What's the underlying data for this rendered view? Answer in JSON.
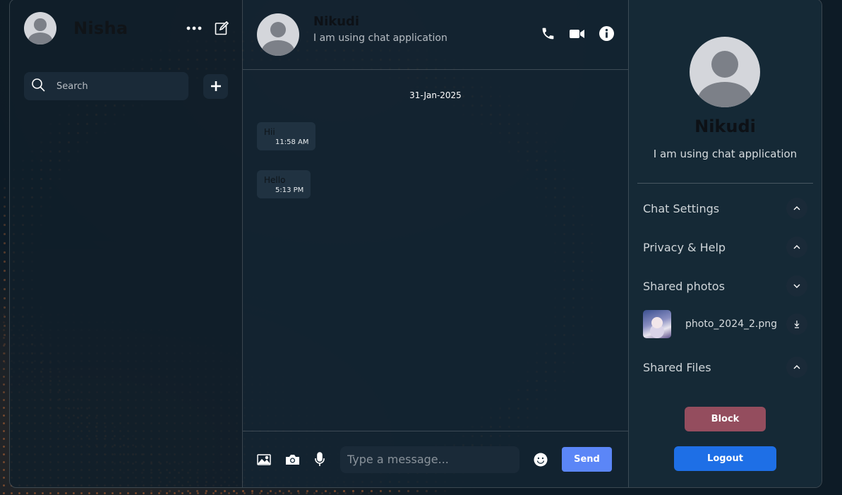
{
  "sidebar": {
    "username": "Nisha",
    "search_placeholder": "Search"
  },
  "chat": {
    "contact_name": "Nikudi",
    "contact_status": "I am using chat application",
    "date": "31-Jan-2025",
    "messages": [
      {
        "text": "Hii",
        "time": "11:58 AM"
      },
      {
        "text": "Hello",
        "time": "5:13 PM"
      }
    ],
    "input_placeholder": "Type a message...",
    "send_label": "Send"
  },
  "details": {
    "name": "Nikudi",
    "status": "I am using chat application",
    "options": {
      "chat_settings": "Chat Settings",
      "privacy_help": "Privacy & Help",
      "shared_photos": "Shared photos",
      "shared_files": "Shared Files"
    },
    "photos": [
      {
        "name": "photo_2024_2.png"
      }
    ],
    "block_label": "Block",
    "logout_label": "Logout"
  },
  "colors": {
    "accent": "#5b86f7",
    "block": "#944d5e",
    "logout": "#1e6fe6",
    "dots": "#e07838"
  },
  "icons": [
    "search-icon",
    "plus-icon",
    "more-icon",
    "edit-icon",
    "phone-icon",
    "video-icon",
    "info-icon",
    "image-icon",
    "camera-icon",
    "mic-icon",
    "emoji-icon",
    "chevron-up-icon",
    "chevron-down-icon",
    "download-icon"
  ]
}
